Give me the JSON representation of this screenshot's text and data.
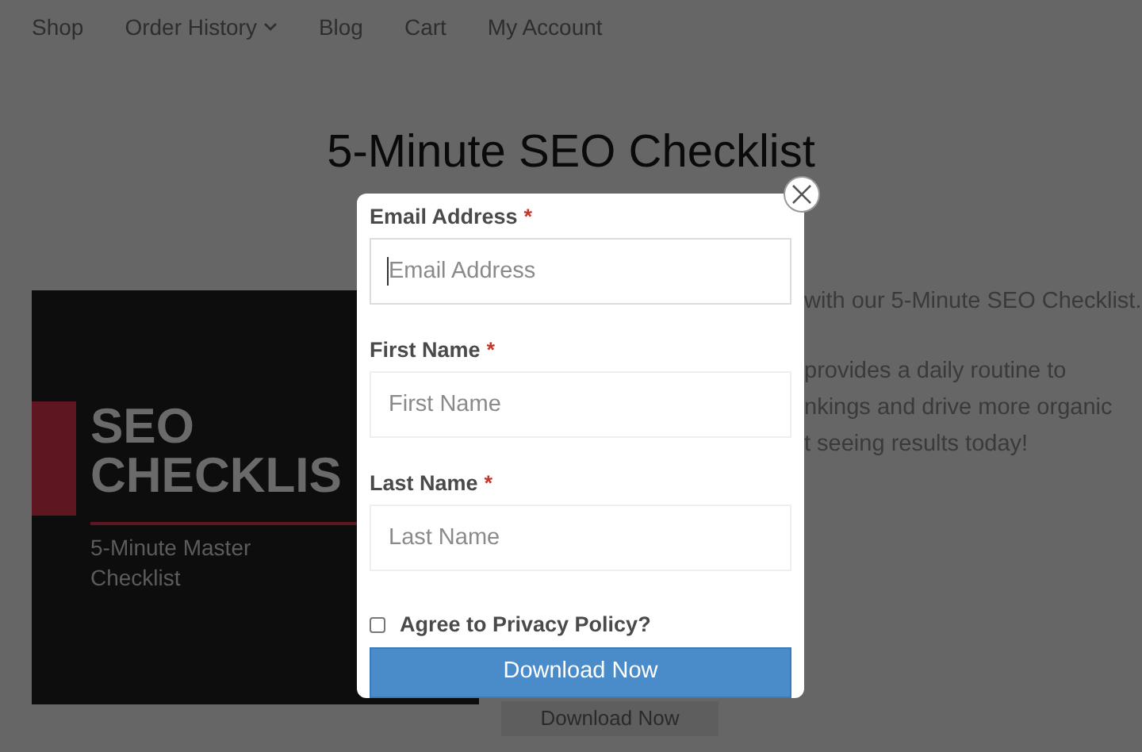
{
  "nav": [
    {
      "label": "Shop",
      "kind": "link"
    },
    {
      "label": "Order History",
      "kind": "dropdown"
    },
    {
      "label": "Blog",
      "kind": "link"
    },
    {
      "label": "Cart",
      "kind": "link"
    },
    {
      "label": "My Account",
      "kind": "link"
    }
  ],
  "title": "5-Minute SEO Checklist",
  "cover": {
    "heading_lines": [
      "SEO",
      "CHECKLIS"
    ],
    "subtitle_lines": [
      "5-Minute Master",
      "Checklist"
    ]
  },
  "description_lines": [
    "with our 5-Minute SEO Checklist.",
    "provides a daily routine to",
    "nkings and drive more organic",
    "t seeing results today!"
  ],
  "page_button": "Download Now",
  "modal": {
    "fields": [
      {
        "label": "Email Address",
        "required": true,
        "required_mark": "*",
        "placeholder": "Email Address",
        "focused": true
      },
      {
        "label": "First Name",
        "required": true,
        "required_mark": "*",
        "placeholder": "First Name",
        "focused": false
      },
      {
        "label": "Last Name",
        "required": true,
        "required_mark": "*",
        "placeholder": "Last Name",
        "focused": false
      }
    ],
    "consent": {
      "label": "Agree to Privacy Policy?",
      "checked": false
    },
    "submit": "Download Now"
  }
}
